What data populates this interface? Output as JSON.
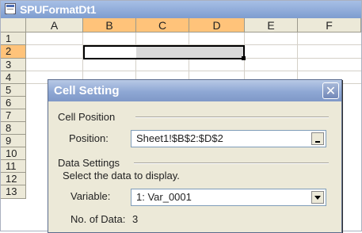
{
  "window": {
    "title": "SPUFormatDt1"
  },
  "sheet": {
    "columns": [
      "A",
      "B",
      "C",
      "D",
      "E",
      "F"
    ],
    "rows": [
      "1",
      "2",
      "3",
      "4",
      "5",
      "6",
      "7",
      "8",
      "9",
      "10",
      "11",
      "12",
      "13"
    ]
  },
  "dialog": {
    "title": "Cell Setting",
    "close_glyph": "✕",
    "cell_position": {
      "group_label": "Cell Position",
      "position_label": "Position:",
      "position_value": "Sheet1!$B$2:$D$2"
    },
    "data_settings": {
      "group_label": "Data Settings",
      "instruction": "Select the data to display.",
      "variable_label": "Variable:",
      "variable_value": "1: Var_0001",
      "count_label": "No. of Data:",
      "count_value": "3"
    }
  }
}
